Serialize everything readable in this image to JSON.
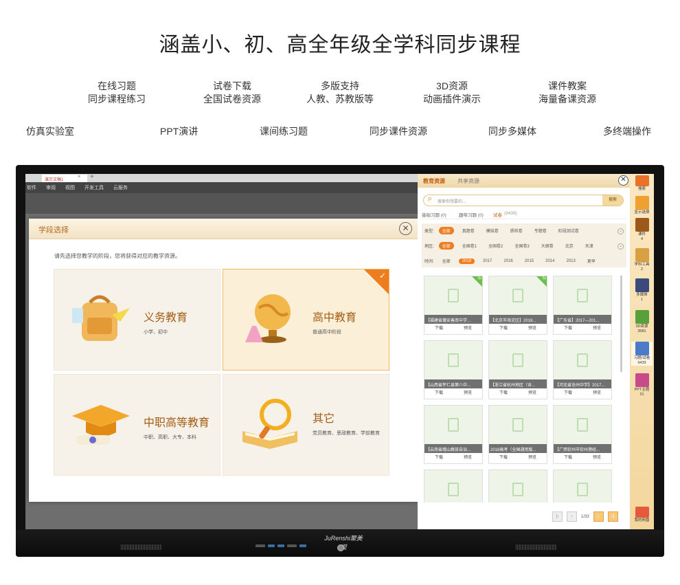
{
  "headline": "涵盖小、初、高全年级全学科同步课程",
  "features_row1": [
    {
      "a": "在线习题",
      "b": "同步课程练习"
    },
    {
      "a": "试卷下载",
      "b": "全国试卷资源"
    },
    {
      "a": "多版支持",
      "b": "人教、苏教版等"
    },
    {
      "a": "3D资源",
      "b": "动画插件演示"
    },
    {
      "a": "课件教案",
      "b": "海量备课资源"
    }
  ],
  "features_row2": [
    "仿真实验室",
    "PPT演讲",
    "课间练习题",
    "同步课件资源",
    "同步多媒体",
    "多终端操作"
  ],
  "app": {
    "doc_tab": "演示文稿1",
    "tab_close": "×",
    "tab_plus": "+",
    "menu": [
      "软件",
      "审阅",
      "视图",
      "开发工具",
      "云服务"
    ]
  },
  "dialog": {
    "title": "学段选择",
    "close": "✕",
    "prompt": "请先选择您教学的阶段，您将获得对应的教学资源。",
    "cards": [
      {
        "title": "义务教育",
        "sub": "小学、初中"
      },
      {
        "title": "高中教育",
        "sub": "普通高中阶段"
      },
      {
        "title": "中职高等教育",
        "sub": "中职、高职、大专、本科"
      },
      {
        "title": "其它",
        "sub": "党员教育、思政教育、学前教育"
      }
    ],
    "check": "✓"
  },
  "panel": {
    "tabs": [
      "教育资源",
      "共享资源"
    ],
    "close": "✕",
    "search_placeholder": "搜索你想要的...",
    "search_button": "搜索",
    "sub_tabs": [
      "基础习题 (0)",
      "趣味习题 (0)",
      "试卷",
      "(9439)"
    ],
    "type_label": "类型:",
    "types": [
      "全部",
      "真题卷",
      "模拟卷",
      "质检卷",
      "专题卷",
      "阶段测试卷"
    ],
    "region_label": "地区:",
    "regions": [
      "全部",
      "全国卷1",
      "全国卷2",
      "全国卷3",
      "大纲卷",
      "北京",
      "天津"
    ],
    "time_label": "时间:",
    "years": [
      "全部",
      "2018",
      "2017",
      "2016",
      "2015",
      "2014",
      "2013",
      "更早"
    ],
    "toggle": "⌄",
    "tiles": [
      {
        "cap": "【福建省莆安善南中学...",
        "badge": "2p"
      },
      {
        "cap": "【北京市海淀区】2018...",
        "badge": "2p"
      },
      {
        "cap": "【广东省】2017—201...",
        "badge": ""
      },
      {
        "cap": "【山西省怀仁县第八中...",
        "badge": ""
      },
      {
        "cap": "【浙江省杭州地区（含...",
        "badge": ""
      },
      {
        "cap": "【河北省沧州中学】2017...",
        "badge": ""
      },
      {
        "cap": "【云南省峨山彝族自治...",
        "badge": ""
      },
      {
        "cap": "2018高考（全国通用版...",
        "badge": ""
      },
      {
        "cap": "【广西钦州市钦州港经...",
        "badge": ""
      },
      {
        "cap": "",
        "badge": ""
      },
      {
        "cap": "",
        "badge": ""
      },
      {
        "cap": "",
        "badge": ""
      }
    ],
    "download": "下载",
    "preview": "预览",
    "page": "1/33"
  },
  "rail": {
    "search": "搜索",
    "items": [
      {
        "label": "显示选择",
        "count": ""
      },
      {
        "label": "课件",
        "count": "4"
      },
      {
        "label": "学科工具",
        "count": "2"
      },
      {
        "label": "多媒体",
        "count": "1"
      },
      {
        "label": "3D资源",
        "count": "3581"
      },
      {
        "label": "习题/试卷",
        "count": "9439"
      },
      {
        "label": "PPT主题",
        "count": "21"
      },
      {
        "label": "我的网盘",
        "count": ""
      }
    ]
  },
  "brand": "JuRenshi聚美视",
  "colors": {
    "accent": "#ee7d20",
    "title": "#a35c12",
    "panel": "#f3d69c"
  }
}
